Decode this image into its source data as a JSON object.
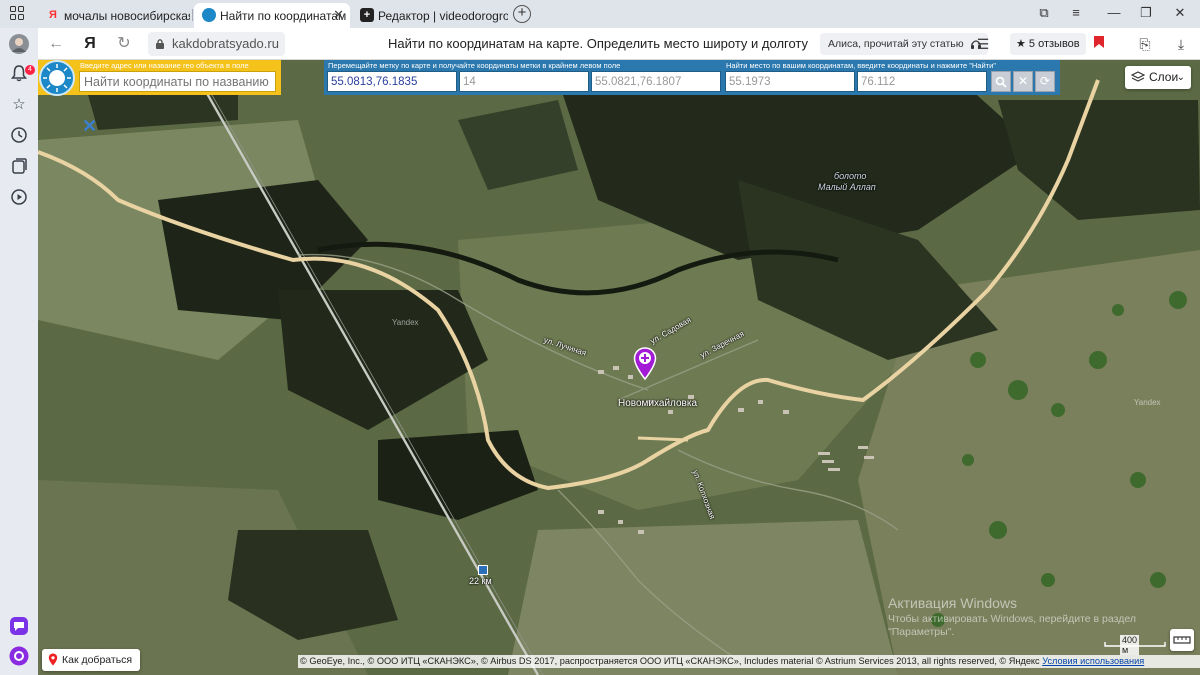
{
  "browser": {
    "tabs": [
      {
        "title": "мочалы новосибирская о",
        "icon": "yandex-icon",
        "active": false
      },
      {
        "title": "Найти по координатам",
        "icon": "site-favicon",
        "active": true
      },
      {
        "title": "Редактор | videodorogros",
        "icon": "editor-icon",
        "active": false
      }
    ],
    "yandex_button": "Я",
    "url": "kakdobratsyado.ru",
    "page_title": "Найти по координатам на карте. Определить место широту и долготу",
    "alice_read": "Алиса, прочитай эту статью",
    "reviews": "★ 5 отзывов"
  },
  "sidebar": {
    "notification_count": "4"
  },
  "search_panel": {
    "hint": "Введите адрес или название гео объекта в поле",
    "placeholder": "Найти координаты по названию"
  },
  "coord_panel": {
    "move_label": "Перемещайте метку по карте и получайте координаты метки в крайнем левом поле",
    "find_label": "Найти место по вашим координатам, введите координаты и нажмите \"Найти\"",
    "marker_coords": "55.0813,76.1835",
    "zoom": "14",
    "center_coords": "55.0821,76.1807",
    "lat_input": "55.1973",
    "lon_input": "76.112"
  },
  "map": {
    "layers_label": "Слои",
    "village_label": "Новомихайловка",
    "swamp_label_1": "болото",
    "swamp_label_2": "Малый Аллап",
    "street_1": "ул. Лучиная",
    "street_2": "ул. Заречная",
    "street_3": "ул. Садовая",
    "street_4": "ул. Колхозная",
    "km_label": "22 км",
    "watermark": "Yandex",
    "route_button": "Как добраться",
    "scale": "400 м",
    "copyright": "© GeoEye, Inc., © ООО ИТЦ «СКАНЭКС», © Airbus DS 2017, распространяется ООО ИТЦ «СКАНЭКС», Includes material © Astrium Services 2013, all rights reserved, © Яндекс",
    "terms": "Условия использования"
  },
  "activation": {
    "title": "Активация Windows",
    "line1": "Чтобы активировать Windows, перейдите в раздел",
    "line2": "\"Параметры\"."
  },
  "colors": {
    "search_panel": "#f4c21b",
    "coord_panel": "#2a78ad",
    "marker": "#a21ad6",
    "road": "#e9d3a3"
  }
}
